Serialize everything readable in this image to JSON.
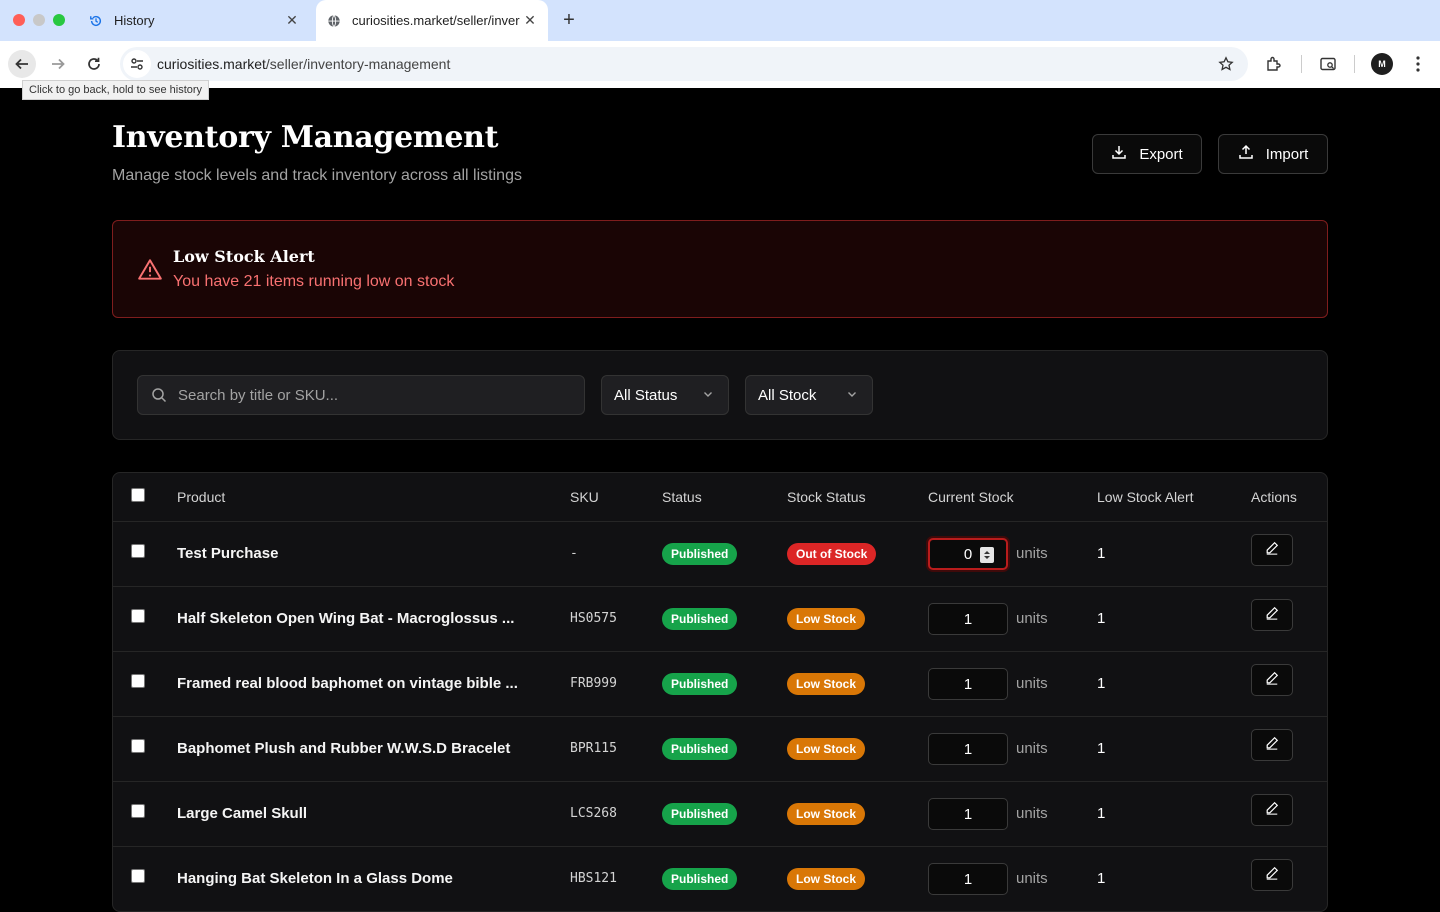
{
  "browser": {
    "tabs": [
      {
        "title": "History",
        "icon": "history-icon"
      },
      {
        "title": "curiosities.market/seller/inver",
        "icon": "globe-icon"
      }
    ],
    "url_domain": "curiosities.market",
    "url_path": "/seller/inventory-management",
    "tooltip": "Click to go back, hold to see history",
    "avatar_text": "M"
  },
  "header": {
    "title": "Inventory Management",
    "subtitle": "Manage stock levels and track inventory across all listings",
    "export_label": "Export",
    "import_label": "Import"
  },
  "alert": {
    "title": "Low Stock Alert",
    "message": "You have 21 items running low on stock"
  },
  "filters": {
    "search_placeholder": "Search by title or SKU...",
    "status_value": "All Status",
    "stock_value": "All Stock"
  },
  "table": {
    "columns": [
      "Product",
      "SKU",
      "Status",
      "Stock Status",
      "Current Stock",
      "Low Stock Alert",
      "Actions"
    ],
    "units_label": "units",
    "rows": [
      {
        "product": "Test Purchase",
        "sku": "-",
        "status": "Published",
        "stock_status": "Out of Stock",
        "stock": "0",
        "low_alert": "1"
      },
      {
        "product": "Half Skeleton Open Wing Bat - Macroglossus ...",
        "sku": "HS0575",
        "status": "Published",
        "stock_status": "Low Stock",
        "stock": "1",
        "low_alert": "1"
      },
      {
        "product": "Framed real blood baphomet on vintage bible ...",
        "sku": "FRB999",
        "status": "Published",
        "stock_status": "Low Stock",
        "stock": "1",
        "low_alert": "1"
      },
      {
        "product": "Baphomet Plush and Rubber W.W.S.D Bracelet",
        "sku": "BPR115",
        "status": "Published",
        "stock_status": "Low Stock",
        "stock": "1",
        "low_alert": "1"
      },
      {
        "product": "Large Camel Skull",
        "sku": "LCS268",
        "status": "Published",
        "stock_status": "Low Stock",
        "stock": "1",
        "low_alert": "1"
      },
      {
        "product": "Hanging Bat Skeleton In a Glass Dome",
        "sku": "HBS121",
        "status": "Published",
        "stock_status": "Low Stock",
        "stock": "1",
        "low_alert": "1"
      }
    ]
  },
  "colors": {
    "published": "#16a34a",
    "out_of_stock": "#dc2626",
    "low_stock": "#d97706",
    "alert_text": "#f87171"
  }
}
